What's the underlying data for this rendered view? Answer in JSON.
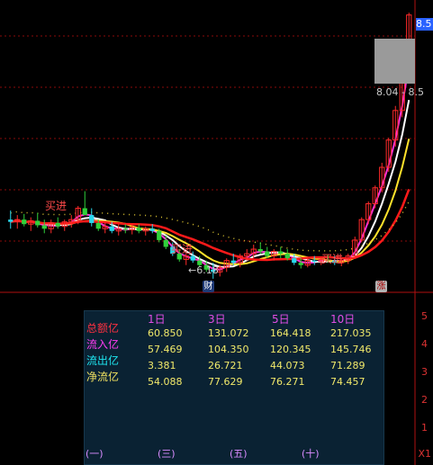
{
  "price_scale": {
    "top_label": "8.5",
    "range_label": "8.04 - 8.5"
  },
  "markers": {
    "low_price": "6.18",
    "buy_signal": "买进",
    "badge_cai": "财",
    "badge_zhang": "涨"
  },
  "right_axis": {
    "ticks": [
      "5",
      "4",
      "3",
      "2",
      "1"
    ],
    "x1": "X1"
  },
  "flow_table": {
    "headers": [
      "1日",
      "3日",
      "5日",
      "10日"
    ],
    "rows": [
      {
        "label": "总额亿",
        "values": [
          "60.850",
          "131.072",
          "164.418",
          "217.035"
        ],
        "color": "#ff3040"
      },
      {
        "label": "流入亿",
        "values": [
          "57.469",
          "104.350",
          "120.345",
          "145.746"
        ],
        "color": "#ff3cf2"
      },
      {
        "label": "流出亿",
        "values": [
          "3.381",
          "26.721",
          "44.073",
          "71.289"
        ],
        "color": "#1ee6f0"
      },
      {
        "label": "净流亿",
        "values": [
          "54.088",
          "77.629",
          "76.271",
          "74.457"
        ],
        "color": "#f0e060"
      }
    ]
  },
  "tabs": [
    "(一)",
    "(三)",
    "(五)",
    "(十)"
  ],
  "colors": {
    "up": "#ff2a2a",
    "down_green": "#2fd13a",
    "down_cyan": "#29d8ec",
    "ma_white": "#ffffff",
    "ma_yellow": "#ffe22b",
    "ma_magenta": "#ff33d6",
    "ma_red": "#ff1a1a",
    "bar_total": "#a8102a",
    "bar_in": "#ff2af0",
    "bar_out": "#15f0ff"
  },
  "chart_data": [
    {
      "type": "candlestick",
      "title": "",
      "series": [
        {
          "name": "",
          "values": [
            {
              "o": 6.7,
              "h": 6.78,
              "l": 6.62,
              "c": 6.68
            },
            {
              "o": 6.68,
              "h": 6.74,
              "l": 6.62,
              "c": 6.7
            },
            {
              "o": 6.7,
              "h": 6.75,
              "l": 6.64,
              "c": 6.66
            },
            {
              "o": 6.66,
              "h": 6.72,
              "l": 6.6,
              "c": 6.69
            },
            {
              "o": 6.69,
              "h": 6.76,
              "l": 6.63,
              "c": 6.65
            },
            {
              "o": 6.65,
              "h": 6.7,
              "l": 6.58,
              "c": 6.62
            },
            {
              "o": 6.62,
              "h": 6.7,
              "l": 6.58,
              "c": 6.67
            },
            {
              "o": 6.67,
              "h": 6.72,
              "l": 6.62,
              "c": 6.64
            },
            {
              "o": 6.64,
              "h": 6.7,
              "l": 6.6,
              "c": 6.68
            },
            {
              "o": 6.68,
              "h": 6.74,
              "l": 6.63,
              "c": 6.7
            },
            {
              "o": 6.7,
              "h": 6.82,
              "l": 6.66,
              "c": 6.8
            },
            {
              "o": 6.8,
              "h": 6.95,
              "l": 6.74,
              "c": 6.74
            },
            {
              "o": 6.74,
              "h": 6.8,
              "l": 6.64,
              "c": 6.67
            },
            {
              "o": 6.67,
              "h": 6.7,
              "l": 6.6,
              "c": 6.62
            },
            {
              "o": 6.62,
              "h": 6.68,
              "l": 6.58,
              "c": 6.64
            },
            {
              "o": 6.64,
              "h": 6.68,
              "l": 6.58,
              "c": 6.6
            },
            {
              "o": 6.6,
              "h": 6.66,
              "l": 6.56,
              "c": 6.62
            },
            {
              "o": 6.62,
              "h": 6.66,
              "l": 6.58,
              "c": 6.61
            },
            {
              "o": 6.61,
              "h": 6.65,
              "l": 6.57,
              "c": 6.63
            },
            {
              "o": 6.63,
              "h": 6.66,
              "l": 6.58,
              "c": 6.6
            },
            {
              "o": 6.6,
              "h": 6.64,
              "l": 6.56,
              "c": 6.62
            },
            {
              "o": 6.62,
              "h": 6.66,
              "l": 6.58,
              "c": 6.6
            },
            {
              "o": 6.6,
              "h": 6.62,
              "l": 6.5,
              "c": 6.52
            },
            {
              "o": 6.52,
              "h": 6.56,
              "l": 6.44,
              "c": 6.46
            },
            {
              "o": 6.46,
              "h": 6.5,
              "l": 6.38,
              "c": 6.4
            },
            {
              "o": 6.4,
              "h": 6.44,
              "l": 6.33,
              "c": 6.35
            },
            {
              "o": 6.35,
              "h": 6.4,
              "l": 6.3,
              "c": 6.38
            },
            {
              "o": 6.38,
              "h": 6.42,
              "l": 6.32,
              "c": 6.34
            },
            {
              "o": 6.34,
              "h": 6.38,
              "l": 6.28,
              "c": 6.3
            },
            {
              "o": 6.3,
              "h": 6.34,
              "l": 6.24,
              "c": 6.26
            },
            {
              "o": 6.26,
              "h": 6.32,
              "l": 6.18,
              "c": 6.24
            },
            {
              "o": 6.24,
              "h": 6.3,
              "l": 6.2,
              "c": 6.28
            },
            {
              "o": 6.28,
              "h": 6.36,
              "l": 6.24,
              "c": 6.34
            },
            {
              "o": 6.34,
              "h": 6.4,
              "l": 6.3,
              "c": 6.32
            },
            {
              "o": 6.32,
              "h": 6.4,
              "l": 6.28,
              "c": 6.38
            },
            {
              "o": 6.38,
              "h": 6.44,
              "l": 6.34,
              "c": 6.4
            },
            {
              "o": 6.4,
              "h": 6.48,
              "l": 6.36,
              "c": 6.44
            },
            {
              "o": 6.44,
              "h": 6.5,
              "l": 6.4,
              "c": 6.42
            },
            {
              "o": 6.42,
              "h": 6.46,
              "l": 6.36,
              "c": 6.38
            },
            {
              "o": 6.38,
              "h": 6.44,
              "l": 6.34,
              "c": 6.42
            },
            {
              "o": 6.42,
              "h": 6.46,
              "l": 6.36,
              "c": 6.4
            },
            {
              "o": 6.4,
              "h": 6.44,
              "l": 6.34,
              "c": 6.36
            },
            {
              "o": 6.36,
              "h": 6.4,
              "l": 6.3,
              "c": 6.32
            },
            {
              "o": 6.32,
              "h": 6.36,
              "l": 6.27,
              "c": 6.3
            },
            {
              "o": 6.3,
              "h": 6.36,
              "l": 6.28,
              "c": 6.34
            },
            {
              "o": 6.34,
              "h": 6.38,
              "l": 6.3,
              "c": 6.33
            },
            {
              "o": 6.33,
              "h": 6.37,
              "l": 6.3,
              "c": 6.35
            },
            {
              "o": 6.35,
              "h": 6.39,
              "l": 6.32,
              "c": 6.34
            },
            {
              "o": 6.34,
              "h": 6.38,
              "l": 6.3,
              "c": 6.32
            },
            {
              "o": 6.32,
              "h": 6.36,
              "l": 6.29,
              "c": 6.34
            },
            {
              "o": 6.34,
              "h": 6.4,
              "l": 6.31,
              "c": 6.38
            },
            {
              "o": 6.38,
              "h": 6.55,
              "l": 6.36,
              "c": 6.52
            },
            {
              "o": 6.52,
              "h": 6.72,
              "l": 6.5,
              "c": 6.7
            },
            {
              "o": 6.7,
              "h": 6.86,
              "l": 6.66,
              "c": 6.84
            },
            {
              "o": 6.84,
              "h": 7.0,
              "l": 6.8,
              "c": 6.98
            },
            {
              "o": 6.98,
              "h": 7.2,
              "l": 6.94,
              "c": 7.16
            },
            {
              "o": 7.16,
              "h": 7.42,
              "l": 7.12,
              "c": 7.4
            },
            {
              "o": 7.4,
              "h": 7.7,
              "l": 7.34,
              "c": 7.66
            },
            {
              "o": 7.66,
              "h": 8.06,
              "l": 7.6,
              "c": 8.04
            },
            {
              "o": 8.04,
              "h": 8.52,
              "l": 8.04,
              "c": 8.5
            }
          ]
        }
      ],
      "ylim": [
        6.1,
        8.6
      ]
    },
    {
      "type": "bar",
      "categories": [
        "1日",
        "3日",
        "5日",
        "10日"
      ],
      "series": [
        {
          "name": "总额亿",
          "values": [
            60.85,
            131.072,
            164.418,
            217.035
          ]
        },
        {
          "name": "流入亿",
          "values": [
            57.469,
            104.35,
            120.345,
            145.746
          ]
        },
        {
          "name": "流出亿",
          "values": [
            3.381,
            26.721,
            44.073,
            71.289
          ]
        }
      ],
      "ylim": [
        0,
        300
      ]
    }
  ]
}
